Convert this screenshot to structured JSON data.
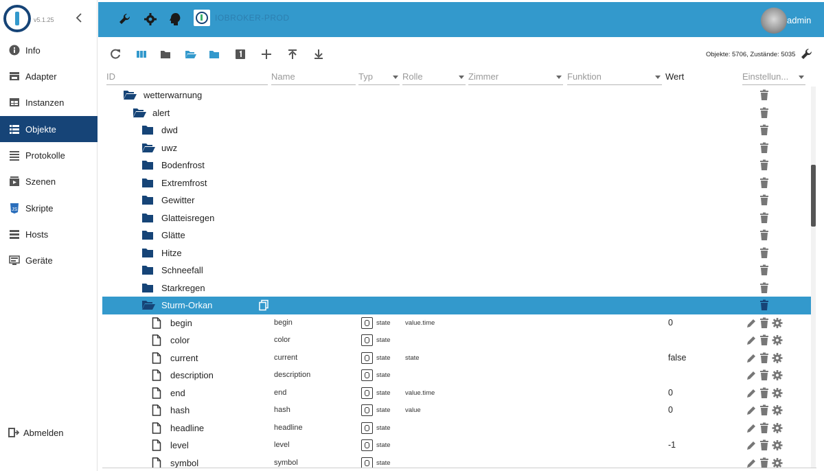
{
  "sidebar": {
    "version": "v5.1.25",
    "collapse_icon": "chevron-left-icon",
    "items": [
      {
        "label": "Info",
        "icon": "info-icon"
      },
      {
        "label": "Adapter",
        "icon": "store-icon"
      },
      {
        "label": "Instanzen",
        "icon": "instances-icon"
      },
      {
        "label": "Objekte",
        "icon": "list-icon",
        "active": true
      },
      {
        "label": "Protokolle",
        "icon": "log-icon"
      },
      {
        "label": "Szenen",
        "icon": "scenes-icon"
      },
      {
        "label": "Skripte",
        "icon": "js-icon"
      },
      {
        "label": "Hosts",
        "icon": "hosts-icon"
      },
      {
        "label": "Geräte",
        "icon": "devices-icon"
      }
    ],
    "logout_label": "Abmelden"
  },
  "header": {
    "host_name": "IOBROKER-PROD",
    "user": "admin",
    "icons": [
      "wrench-icon",
      "settings-gear-icon",
      "brain-icon"
    ]
  },
  "toolbar": {
    "counts_text": "Objekte: 5706, Zustände: 5035"
  },
  "columns": {
    "id": "ID",
    "name": "Name",
    "typ": "Typ",
    "rolle": "Rolle",
    "zimmer": "Zimmer",
    "funktion": "Funktion",
    "wert": "Wert",
    "einstellungen": "Einstellun..."
  },
  "tree": {
    "rows": [
      {
        "label": "wetterwarnung",
        "kind": "folder-open",
        "level": 0
      },
      {
        "label": "alert",
        "kind": "folder-open",
        "level": 1
      },
      {
        "label": "dwd",
        "kind": "folder",
        "level": 2
      },
      {
        "label": "uwz",
        "kind": "folder-open",
        "level": 2
      },
      {
        "label": "Bodenfrost",
        "kind": "folder",
        "level": 3
      },
      {
        "label": "Extremfrost",
        "kind": "folder",
        "level": 3
      },
      {
        "label": "Gewitter",
        "kind": "folder",
        "level": 3
      },
      {
        "label": "Glatteisregen",
        "kind": "folder",
        "level": 3
      },
      {
        "label": "Glätte",
        "kind": "folder",
        "level": 3
      },
      {
        "label": "Hitze",
        "kind": "folder",
        "level": 3
      },
      {
        "label": "Schneefall",
        "kind": "folder",
        "level": 3
      },
      {
        "label": "Starkregen",
        "kind": "folder",
        "level": 3
      },
      {
        "label": "Sturm-Orkan",
        "kind": "folder-open",
        "level": 3,
        "selected": true
      },
      {
        "label": "begin",
        "kind": "state",
        "level": 4,
        "name": "begin",
        "type": "state",
        "role": "value.time",
        "value": "0"
      },
      {
        "label": "color",
        "kind": "state",
        "level": 4,
        "name": "color",
        "type": "state",
        "role": "",
        "value": ""
      },
      {
        "label": "current",
        "kind": "state",
        "level": 4,
        "name": "current",
        "type": "state",
        "role": "state",
        "value": "false"
      },
      {
        "label": "description",
        "kind": "state",
        "level": 4,
        "name": "description",
        "type": "state",
        "role": "",
        "value": ""
      },
      {
        "label": "end",
        "kind": "state",
        "level": 4,
        "name": "end",
        "type": "state",
        "role": "value.time",
        "value": "0"
      },
      {
        "label": "hash",
        "kind": "state",
        "level": 4,
        "name": "hash",
        "type": "state",
        "role": "value",
        "value": "0"
      },
      {
        "label": "headline",
        "kind": "state",
        "level": 4,
        "name": "headline",
        "type": "state",
        "role": "",
        "value": ""
      },
      {
        "label": "level",
        "kind": "state",
        "level": 4,
        "name": "level",
        "type": "state",
        "role": "",
        "value": "-1"
      },
      {
        "label": "symbol",
        "kind": "state",
        "level": 4,
        "name": "symbol",
        "type": "state",
        "role": "",
        "value": ""
      }
    ]
  },
  "colors": {
    "primary": "#3399cc",
    "dark_blue": "#164477",
    "folder": "#164477"
  }
}
